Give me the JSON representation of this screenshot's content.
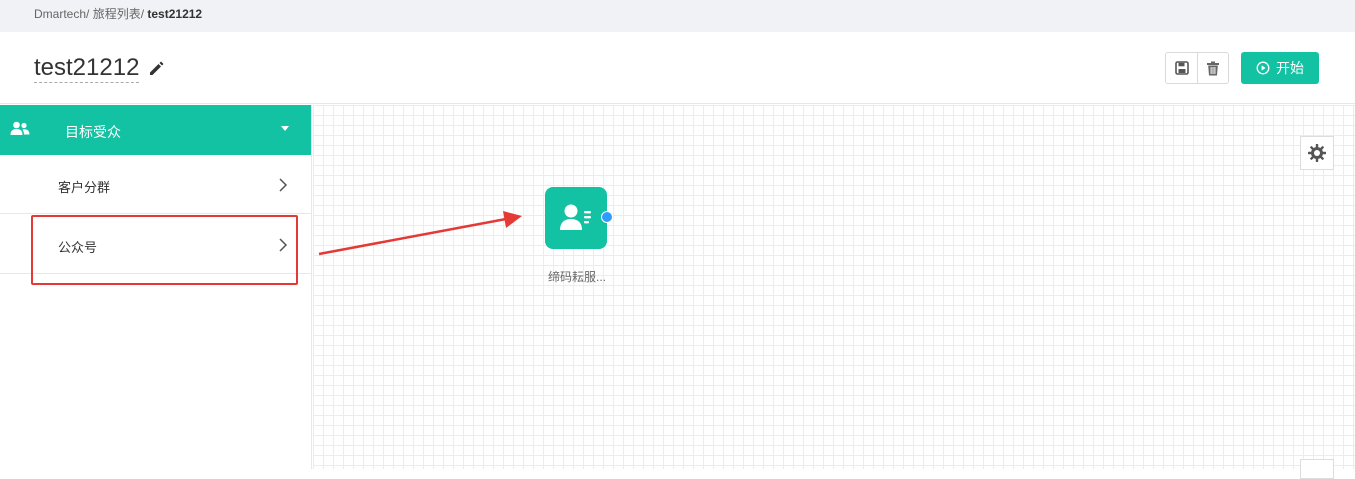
{
  "breadcrumb": {
    "root": "Dmartech/",
    "list": "旅程列表/",
    "current": "test21212"
  },
  "header": {
    "title": "test21212",
    "start_label": "开始"
  },
  "sidebar": {
    "group_label": "目标受众",
    "items": [
      {
        "label": "客户分群"
      },
      {
        "label": "公众号"
      }
    ]
  },
  "canvas": {
    "node": {
      "label": "缔码耘服..."
    }
  },
  "colors": {
    "accent": "#13c2a3",
    "annotation": "#e53935",
    "port": "#2f9bff"
  }
}
